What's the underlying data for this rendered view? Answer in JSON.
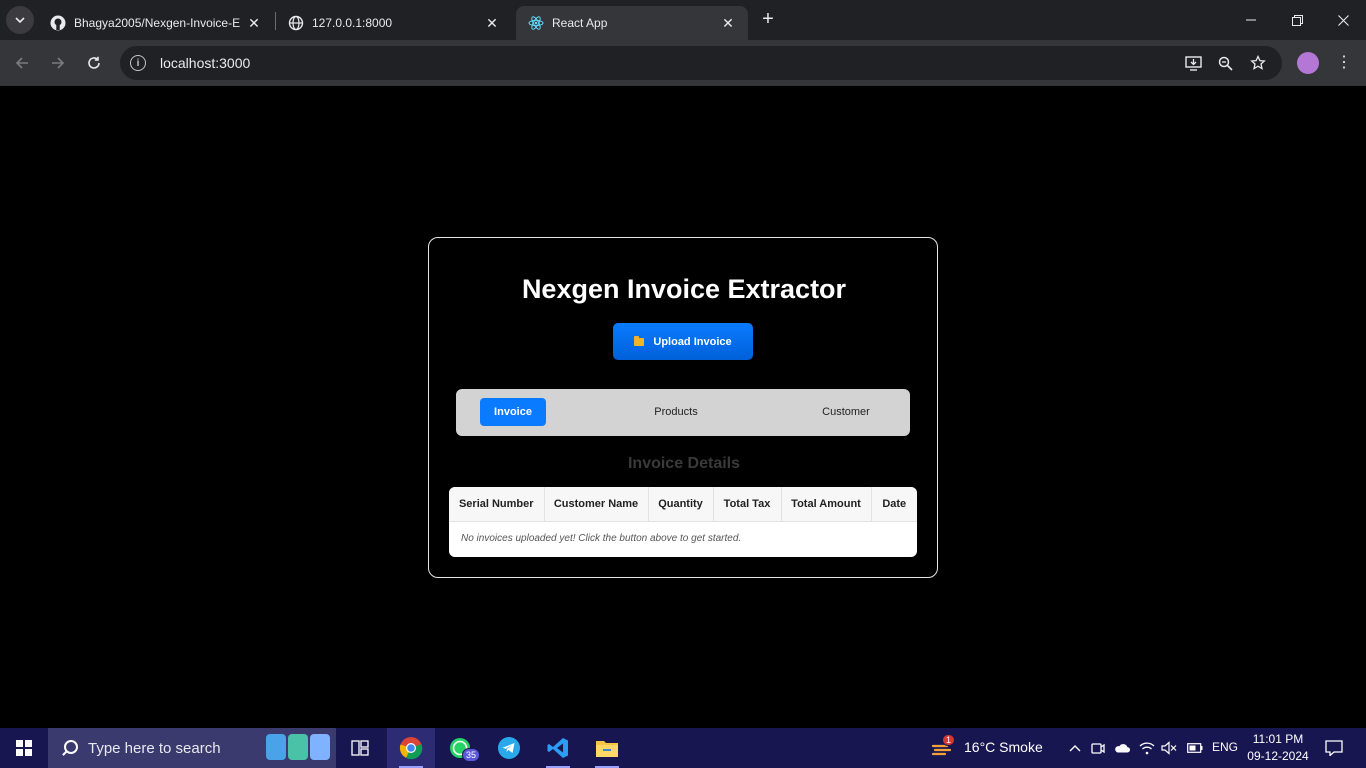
{
  "browser": {
    "tabs": [
      {
        "title": "Bhagya2005/Nexgen-Invoice-Ex",
        "favicon": "github-icon"
      },
      {
        "title": "127.0.0.1:8000",
        "favicon": "globe-icon"
      },
      {
        "title": "React App",
        "favicon": "react-icon",
        "active": true
      }
    ],
    "url": "localhost:3000"
  },
  "app": {
    "title": "Nexgen Invoice Extractor",
    "upload_label": "Upload Invoice",
    "tabs": [
      {
        "label": "Invoice",
        "active": true
      },
      {
        "label": "Products"
      },
      {
        "label": "Customer"
      }
    ],
    "section_title": "Invoice Details",
    "table": {
      "columns": [
        "Serial Number",
        "Customer Name",
        "Quantity",
        "Total Tax",
        "Total Amount",
        "Date"
      ],
      "empty_message": "No invoices uploaded yet! Click the button above to get started."
    },
    "colors": {
      "accent": "#0a7bff",
      "tabs_bar": "#d3d3d3",
      "card_border": "#e6e6e6"
    }
  },
  "taskbar": {
    "search_placeholder": "Type here to search",
    "whatsapp_badge": "35",
    "weather_badge": "1",
    "weather": "16°C  Smoke",
    "language": "ENG",
    "time": "11:01 PM",
    "date": "09-12-2024"
  }
}
